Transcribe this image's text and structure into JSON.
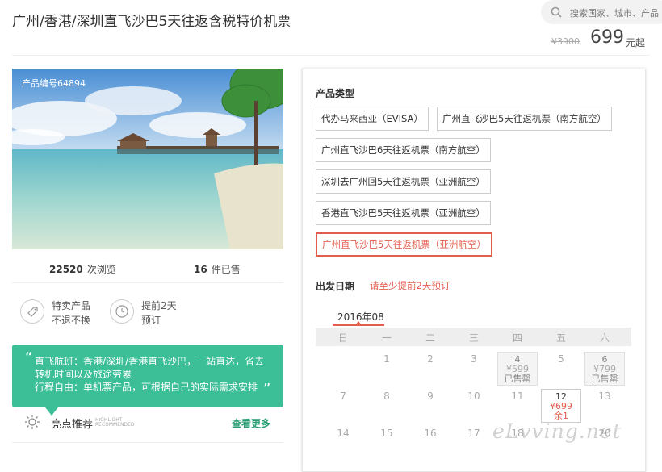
{
  "header": {
    "title": "广州/香港/深圳直飞沙巴5天往返含税特价机票",
    "search_placeholder": "搜索国家、城市、产品"
  },
  "price": {
    "original": "¥3900",
    "current": "699",
    "unit": "元起"
  },
  "product": {
    "id_label": "产品编号64894",
    "views_count": "22520",
    "views_label": "次浏览",
    "sold_count": "16",
    "sold_label": "件已售"
  },
  "features": [
    {
      "icon": "tag-icon",
      "line1": "特卖产品",
      "line2": "不退不换"
    },
    {
      "icon": "clock-icon",
      "line1": "提前2天",
      "line2": "预订"
    }
  ],
  "highlight": {
    "open_quote": "“",
    "close_quote": "”",
    "text": "直飞航班：香港/深圳/香港直飞沙巴，一站直达，省去转机时间以及旅途劳累\n行程自由：单机票产品，可根据自己的实际需求安排",
    "label": "亮点推荐",
    "label_en_1": "HIGHLIGHT",
    "label_en_2": "RECOMMENDED",
    "more": "查看更多"
  },
  "options": {
    "title": "产品类型",
    "items": [
      "代办马来西亚（EVISA）",
      "广州直飞沙巴5天往返机票（南方航空）",
      "广州直飞沙巴6天往返机票（南方航空）",
      "深圳去广州回5天往返机票（亚洲航空）",
      "香港直飞沙巴5天往返机票（亚洲航空）",
      "广州直飞沙巴5天往返机票（亚洲航空）"
    ],
    "selected_index": 5
  },
  "calendar": {
    "title": "出发日期",
    "note": "请至少提前2天预订",
    "month": "2016年08",
    "weekdays": [
      "日",
      "一",
      "二",
      "三",
      "四",
      "五",
      "六"
    ],
    "days": [
      "1",
      "2",
      "3",
      "4",
      "5",
      "6",
      "7",
      "8",
      "9",
      "10",
      "11",
      "12",
      "13",
      "14",
      "15",
      "16",
      "17",
      "18",
      "19",
      "20"
    ],
    "cell_4": {
      "day": "4",
      "price": "¥599",
      "status": "已售罄"
    },
    "cell_6": {
      "day": "6",
      "price": "¥799",
      "status": "已售罄"
    },
    "cell_12": {
      "day": "12",
      "price": "¥699",
      "status": "余1"
    }
  },
  "watermark": "eLvving.net",
  "colors": {
    "accent": "#e35d4f",
    "green": "#3cbf96"
  }
}
